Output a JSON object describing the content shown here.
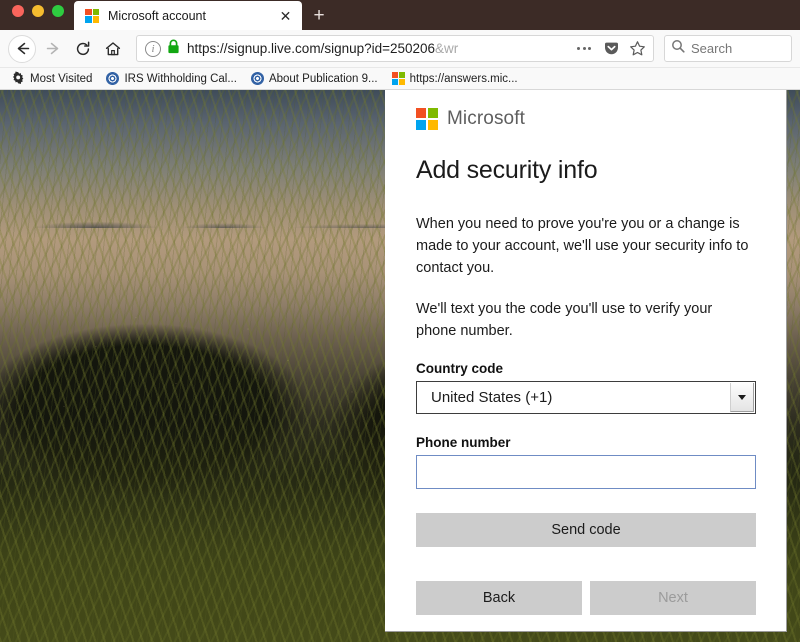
{
  "browser": {
    "window_controls": [
      "close",
      "minimize",
      "zoom"
    ],
    "tab": {
      "title": "Microsoft account",
      "favicon": "microsoft-logo-icon",
      "close_label": "✕"
    },
    "new_tab_label": "+",
    "nav": {
      "back_icon": "back-arrow-icon",
      "forward_icon": "forward-arrow-icon",
      "reload_icon": "reload-icon",
      "home_icon": "home-icon"
    },
    "address_bar": {
      "info_icon": "page-info-icon",
      "lock_icon": "padlock-secure-icon",
      "url_visible": "https://signup.live.com/signup?id=250206",
      "url_faded": "&wr",
      "page_actions_icon": "ellipsis-icon",
      "pocket_icon": "pocket-icon",
      "bookmark_icon": "star-icon"
    },
    "search": {
      "placeholder": "Search",
      "icon": "search-icon"
    },
    "bookmarks": [
      {
        "label": "Most Visited",
        "icon": "gear-icon"
      },
      {
        "label": "IRS Withholding Cal...",
        "icon": "irs-seal-icon"
      },
      {
        "label": "About Publication 9...",
        "icon": "irs-seal-icon"
      },
      {
        "label": "https://answers.mic...",
        "icon": "microsoft-logo-icon"
      }
    ]
  },
  "page": {
    "brand": "Microsoft",
    "brand_icon": "microsoft-logo-icon",
    "title": "Add security info",
    "paragraph_1": "When you need to prove you're you or a change is made to your account, we'll use your security info to contact you.",
    "paragraph_2": "We'll text you the code you'll use to verify your phone number.",
    "country_code": {
      "label": "Country code",
      "value": "United States (+1)",
      "caret_icon": "chevron-down-icon"
    },
    "phone_number": {
      "label": "Phone number",
      "value": "",
      "placeholder": ""
    },
    "send_code_label": "Send code",
    "back_label": "Back",
    "next_label": "Next"
  },
  "colors": {
    "titlebar": "#3c2b26",
    "ms_red": "#f25022",
    "ms_green": "#7fba00",
    "ms_blue": "#00a4ef",
    "ms_yellow": "#ffb900",
    "button_gray": "#cccccc",
    "focus_border": "#6f8cc4"
  }
}
